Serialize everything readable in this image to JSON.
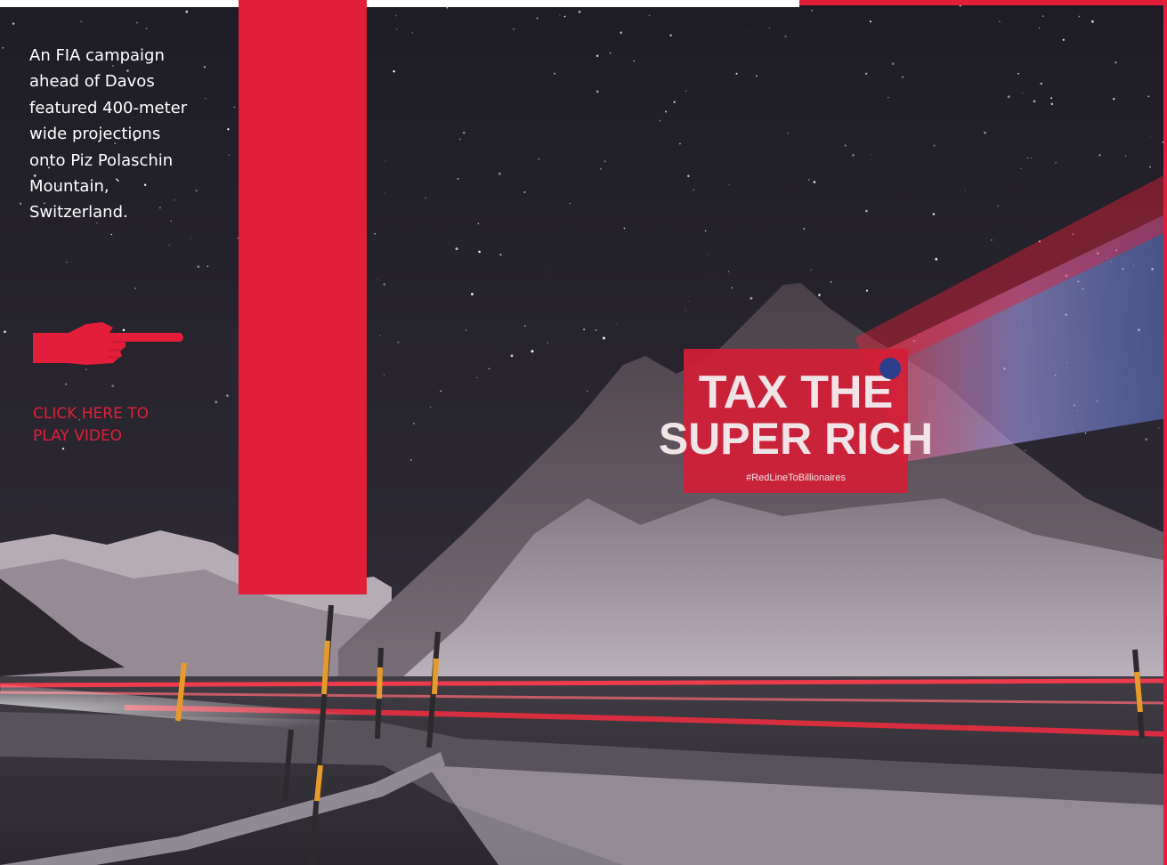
{
  "caption": {
    "lines": [
      "An FIA campaign",
      "ahead of Davos",
      "featured 400-meter",
      "wide projections",
      "onto Piz Polaschin",
      "Mountain, `",
      "Switzerland."
    ]
  },
  "cta": {
    "lines": [
      "CLICK HERE TO",
      "PLAY VIDEO"
    ],
    "icon": "pointing-hand-icon"
  },
  "projection": {
    "line1": "TAX THE",
    "line2": "SUPER RICH",
    "hashtag": "#RedLineToBillionaires"
  },
  "colors": {
    "accent_red": "#e21e3a",
    "sky": "#24222c",
    "snow": "#d9d4dc"
  }
}
